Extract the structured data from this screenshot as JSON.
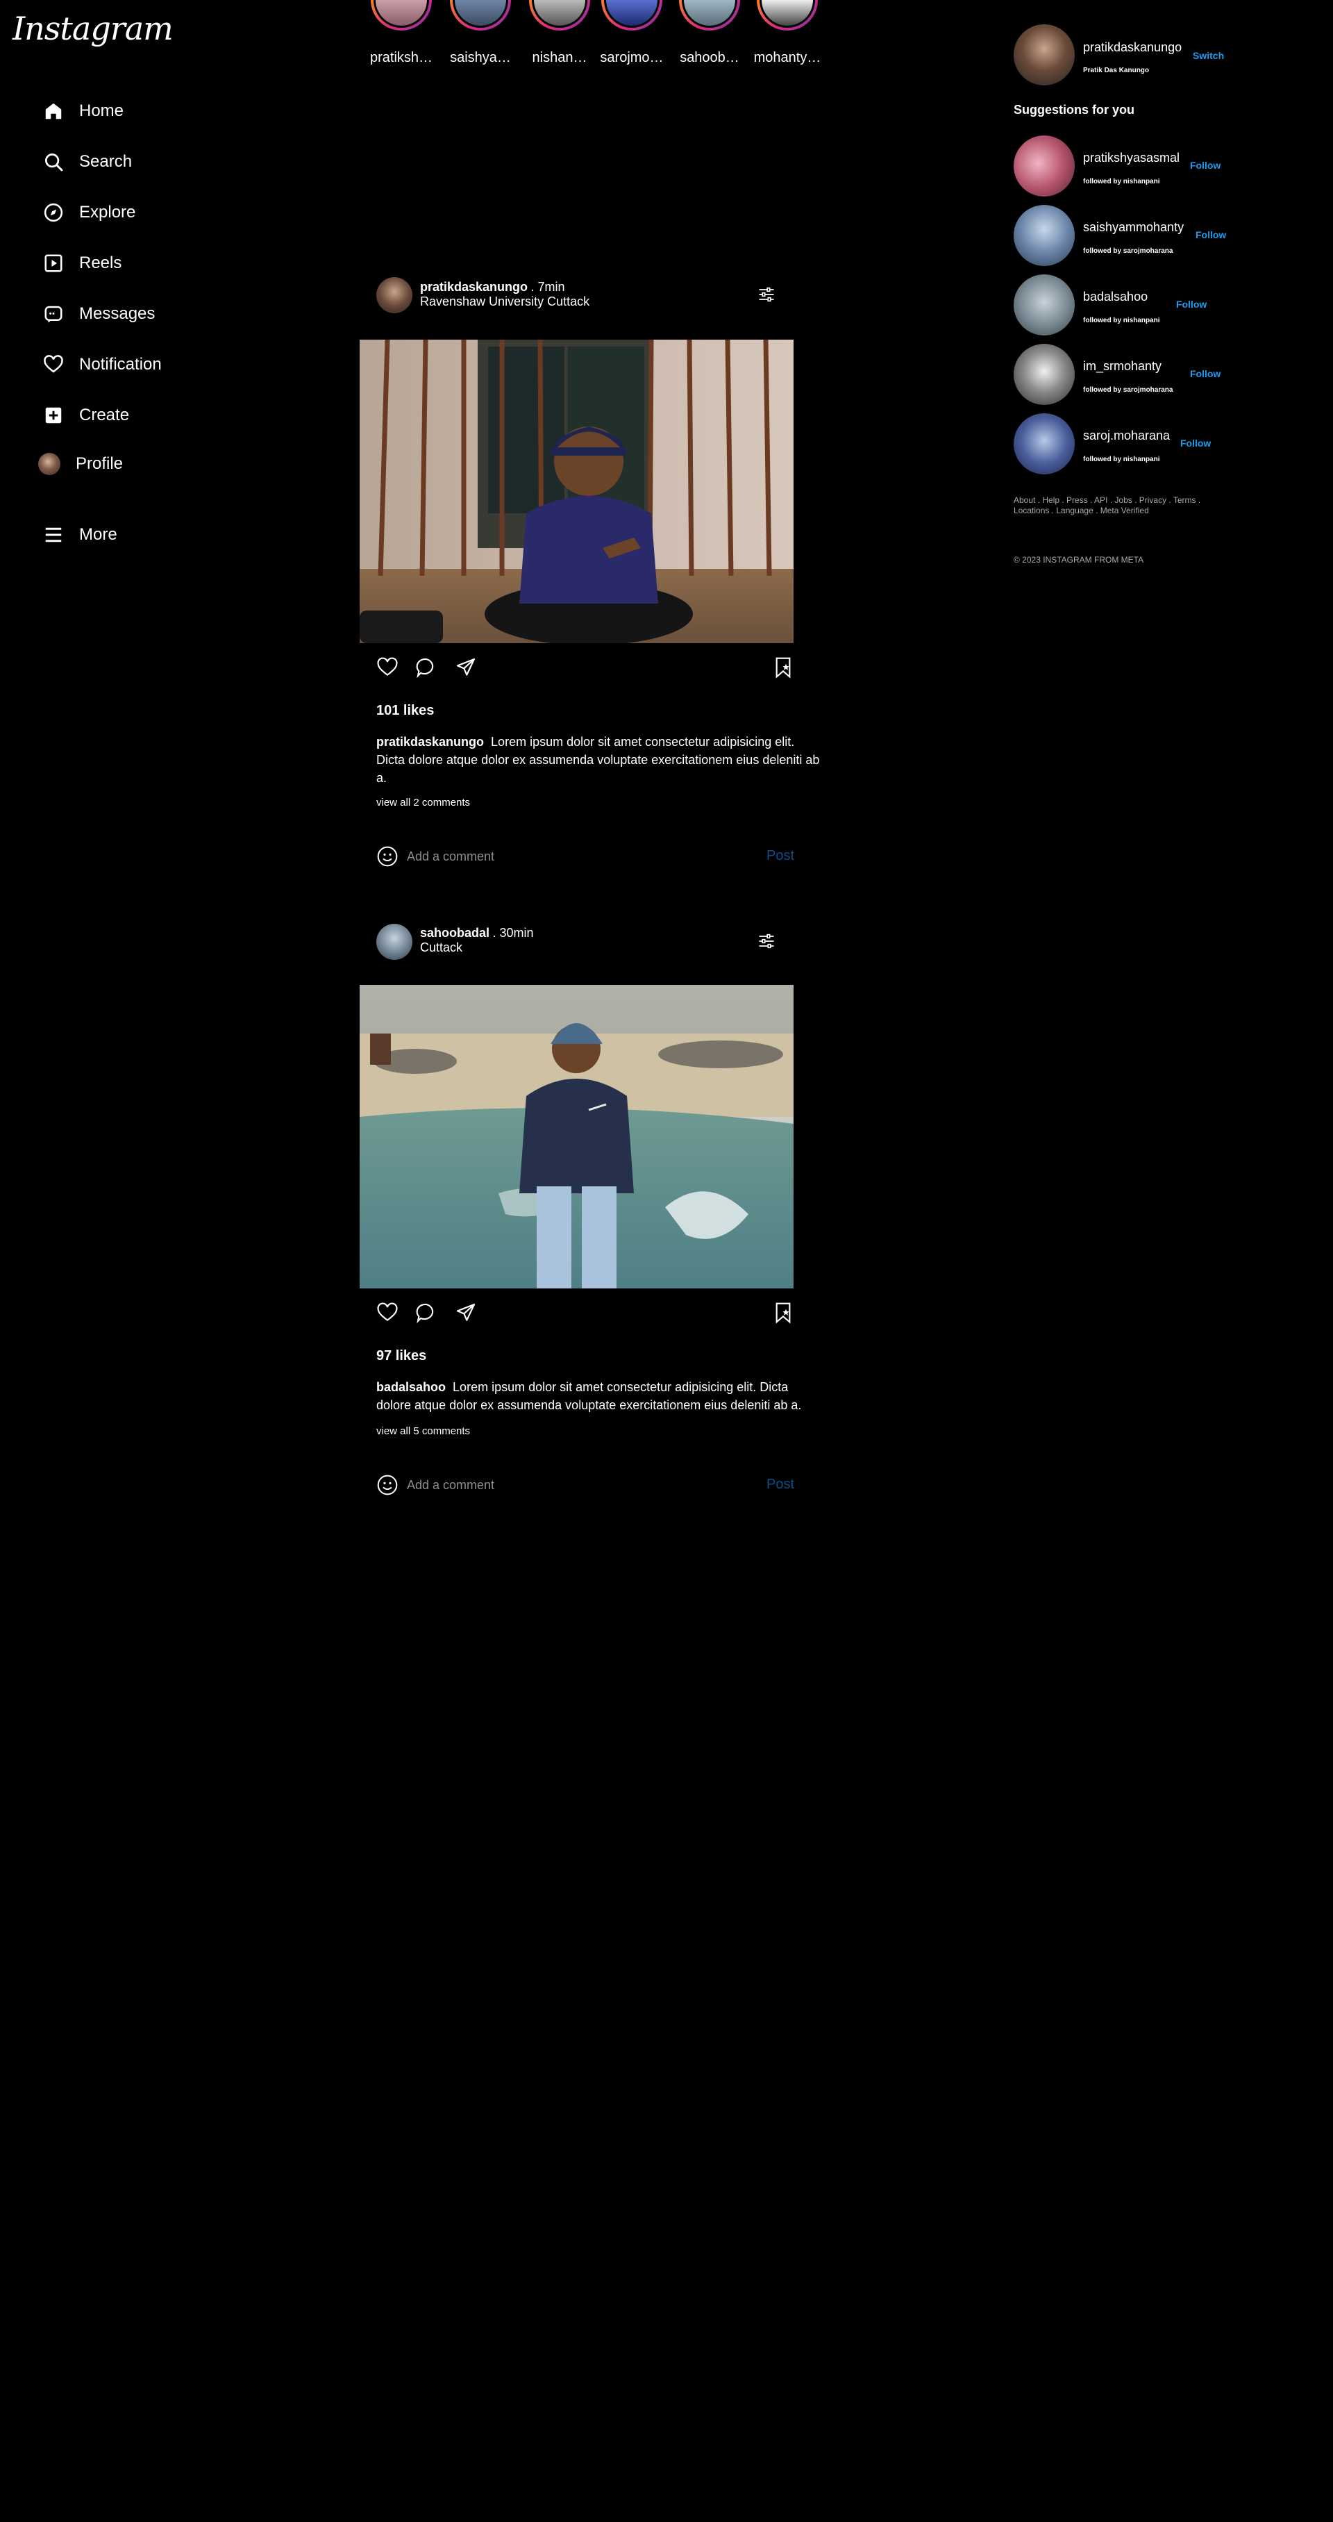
{
  "brand": {
    "logo": "Instagram"
  },
  "nav": {
    "home": "Home",
    "search": "Search",
    "explore": "Explore",
    "reels": "Reels",
    "messages": "Messages",
    "notification": "Notification",
    "create": "Create",
    "profile": "Profile",
    "more": "More"
  },
  "stories": [
    {
      "name": "pratiksh…"
    },
    {
      "name": "saishya…"
    },
    {
      "name": "nishan…"
    },
    {
      "name": "sarojmo…"
    },
    {
      "name": "sahoob…"
    },
    {
      "name": "mohanty…"
    }
  ],
  "posts": [
    {
      "username": "pratikdaskanungo",
      "time": ". 7min",
      "location": "Ravenshaw University Cuttack",
      "likes": "101 likes",
      "caption_user": "pratikdaskanungo",
      "caption_text": "Lorem ipsum dolor sit amet consectetur adipisicing elit. Dicta dolore atque dolor ex assumenda voluptate exercitationem eius deleniti ab a.",
      "view_all": "view all 2 comments",
      "comment_placeholder": "Add a comment",
      "post_label": "Post"
    },
    {
      "username": "sahoobadal",
      "time": ". 30min",
      "location": "Cuttack",
      "likes": "97 likes",
      "caption_user": "badalsahoo",
      "caption_text": "Lorem ipsum dolor sit amet consectetur adipisicing elit. Dicta dolore atque dolor ex assumenda voluptate exercitationem eius deleniti ab a.",
      "view_all": "view all 5 comments",
      "comment_placeholder": "Add a comment",
      "post_label": "Post"
    }
  ],
  "account": {
    "username": "pratikdaskanungo",
    "fullname": "Pratik Das Kanungo",
    "switch_label": "Switch"
  },
  "suggestions": {
    "title": "Suggestions for you",
    "items": [
      {
        "username": "pratikshyasasmal",
        "sub": "followed by nishanpani",
        "follow": "Follow"
      },
      {
        "username": "saishyammohanty",
        "sub": "followed by sarojmoharana",
        "follow": "Follow"
      },
      {
        "username": "badalsahoo",
        "sub": "followed by nishanpani",
        "follow": "Follow"
      },
      {
        "username": "im_srmohanty",
        "sub": "followed by sarojmoharana",
        "follow": "Follow"
      },
      {
        "username": "saroj.moharana",
        "sub": "followed by nishanpani",
        "follow": "Follow"
      }
    ]
  },
  "footer": {
    "links": "About . Help . Press . API . Jobs . Privacy . Terms . Locations . Language . Meta Verified",
    "copyright": "© 2023 INSTAGRAM FROM META"
  },
  "colors": {
    "background": "#000000",
    "follow": "#1e9bf0",
    "post_button": "#0b4f8a",
    "story_ring_start": "#f58529",
    "story_ring_end": "#8134af"
  },
  "icons": [
    "home-icon",
    "search-icon",
    "explore-icon",
    "reels-icon",
    "messages-icon",
    "heart-icon",
    "create-icon",
    "more-icon",
    "comment-icon",
    "share-icon",
    "bookmark-icon",
    "filter-icon",
    "emoji-icon"
  ]
}
